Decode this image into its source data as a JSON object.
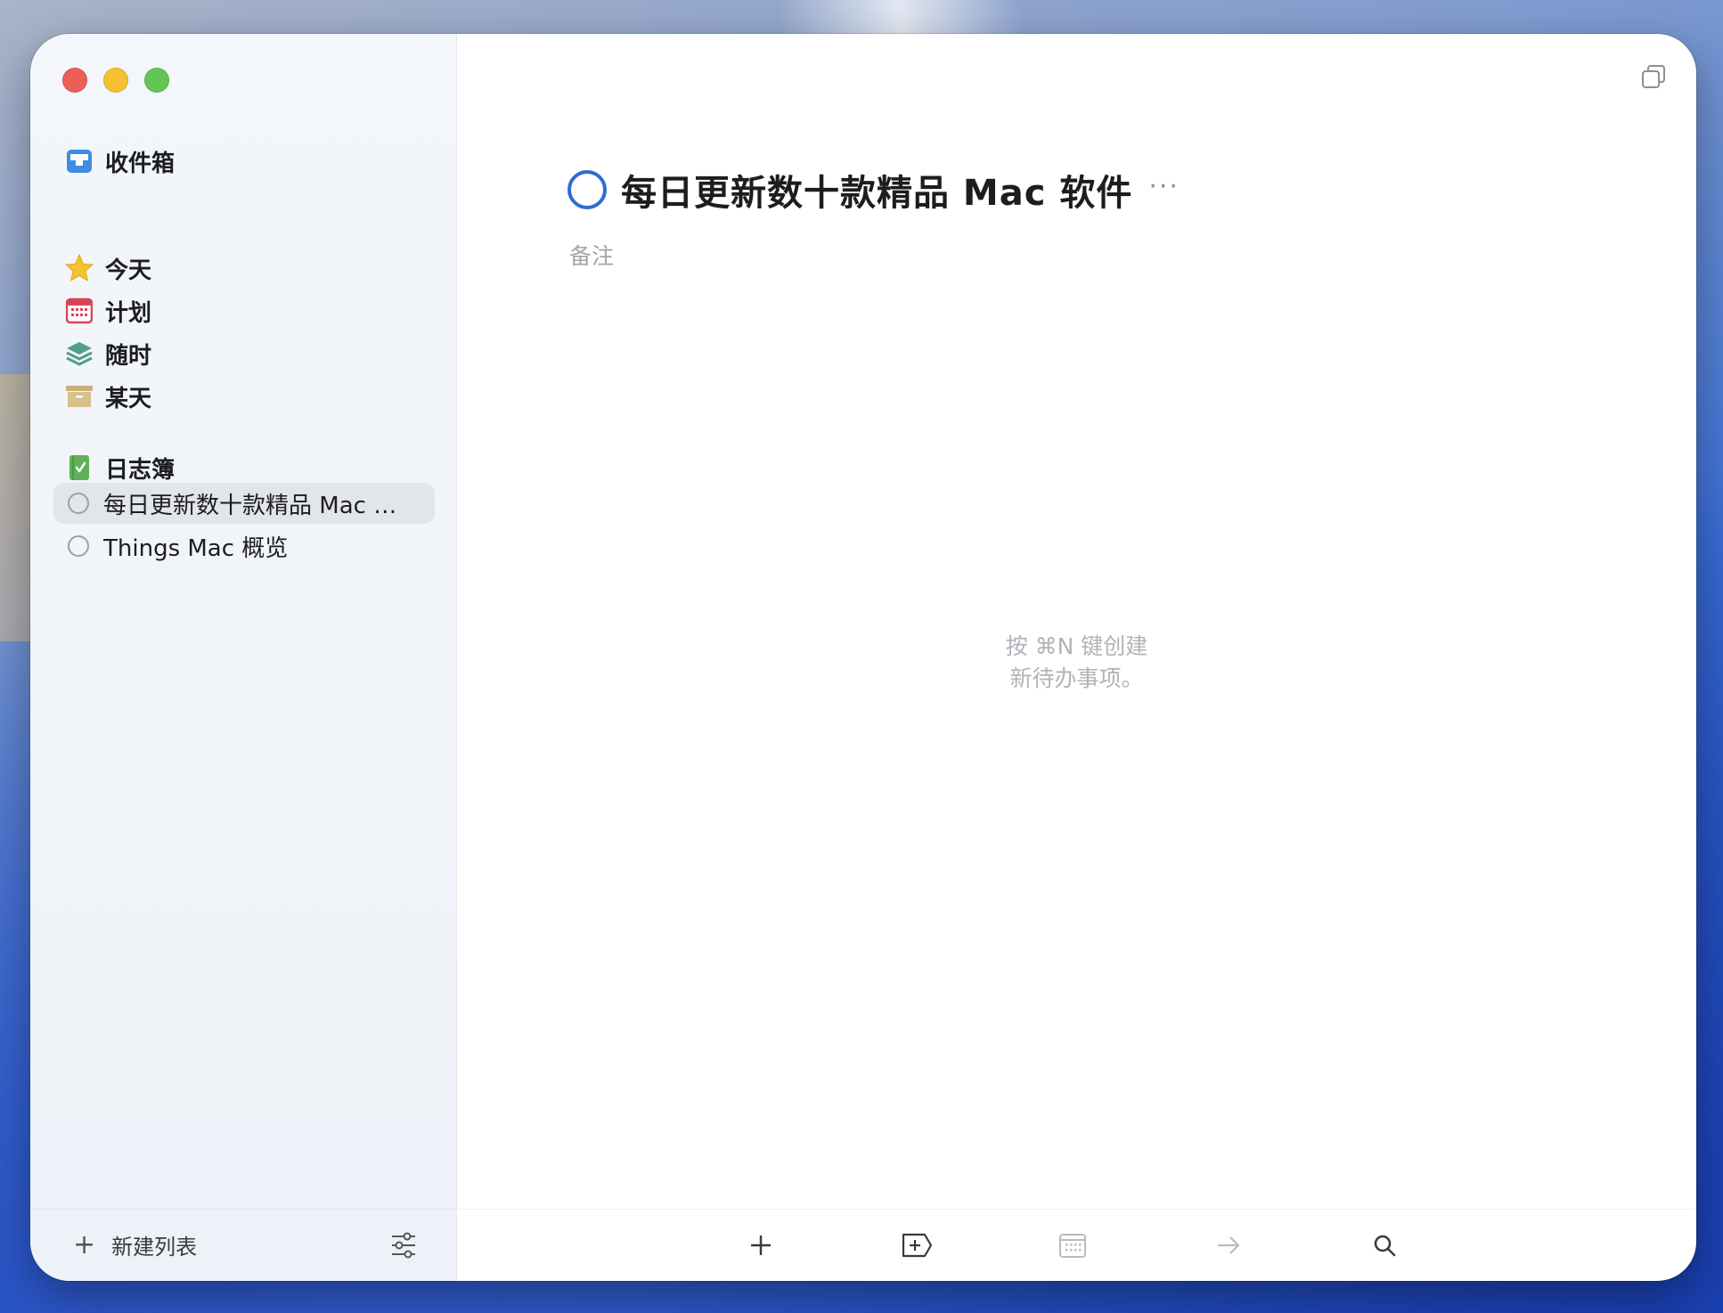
{
  "sidebar": {
    "inbox": {
      "label": "收件箱",
      "icon": "inbox-icon"
    },
    "smart_lists": [
      {
        "label": "今天",
        "icon": "star-icon"
      },
      {
        "label": "计划",
        "icon": "calendar-icon"
      },
      {
        "label": "随时",
        "icon": "layers-icon"
      },
      {
        "label": "某天",
        "icon": "archive-box-icon"
      }
    ],
    "logbook": {
      "label": "日志簿",
      "icon": "logbook-icon"
    },
    "projects": [
      {
        "label": "每日更新数十款精品 Mac 软件",
        "selected": true
      },
      {
        "label": "Things Mac 概览",
        "selected": false
      }
    ],
    "footer": {
      "new_list_label": "新建列表"
    }
  },
  "main": {
    "title": "每日更新数十款精品 Mac 软件",
    "more": "···",
    "notes_placeholder": "备注",
    "empty_hint_line1": "按 ⌘N 键创建",
    "empty_hint_line2": "新待办事项。"
  },
  "toolbar": {
    "buttons": [
      "add-todo",
      "add-heading",
      "when-date",
      "move",
      "search"
    ]
  },
  "colors": {
    "accent": "#2f6bd1",
    "inbox": "#3f8de0",
    "today_star": "#f4c131",
    "calendar": "#d9435a",
    "anytime": "#4f9e8e",
    "someday": "#c9b27a",
    "logbook": "#5fb157"
  }
}
